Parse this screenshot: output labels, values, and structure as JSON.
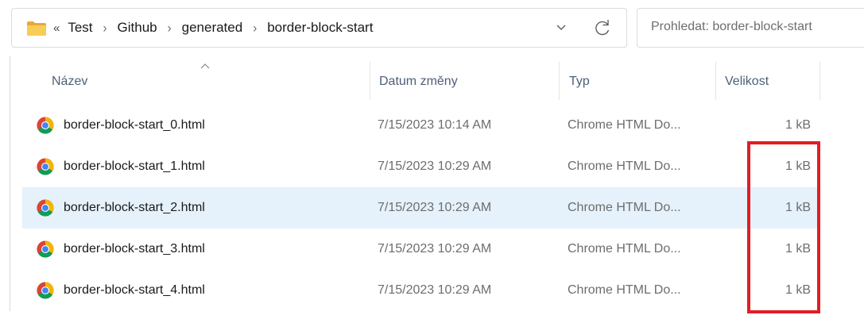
{
  "addressbar": {
    "overflow": "«",
    "crumbs": [
      "Test",
      "Github",
      "generated",
      "border-block-start"
    ],
    "separator": "›"
  },
  "search": {
    "placeholder": "Prohledat: border-block-start"
  },
  "columns": {
    "name": "Název",
    "date": "Datum změny",
    "type": "Typ",
    "size": "Velikost"
  },
  "files": [
    {
      "name": "border-block-start_0.html",
      "date": "7/15/2023 10:14 AM",
      "type": "Chrome HTML Do...",
      "size": "1 kB"
    },
    {
      "name": "border-block-start_1.html",
      "date": "7/15/2023 10:29 AM",
      "type": "Chrome HTML Do...",
      "size": "1 kB"
    },
    {
      "name": "border-block-start_2.html",
      "date": "7/15/2023 10:29 AM",
      "type": "Chrome HTML Do...",
      "size": "1 kB"
    },
    {
      "name": "border-block-start_3.html",
      "date": "7/15/2023 10:29 AM",
      "type": "Chrome HTML Do...",
      "size": "1 kB"
    },
    {
      "name": "border-block-start_4.html",
      "date": "7/15/2023 10:29 AM",
      "type": "Chrome HTML Do...",
      "size": "1 kB"
    }
  ],
  "selected_index": 2,
  "colors": {
    "highlight": "#e01e24",
    "selected_row": "#e5f1fb",
    "folder": "#f7c948"
  }
}
